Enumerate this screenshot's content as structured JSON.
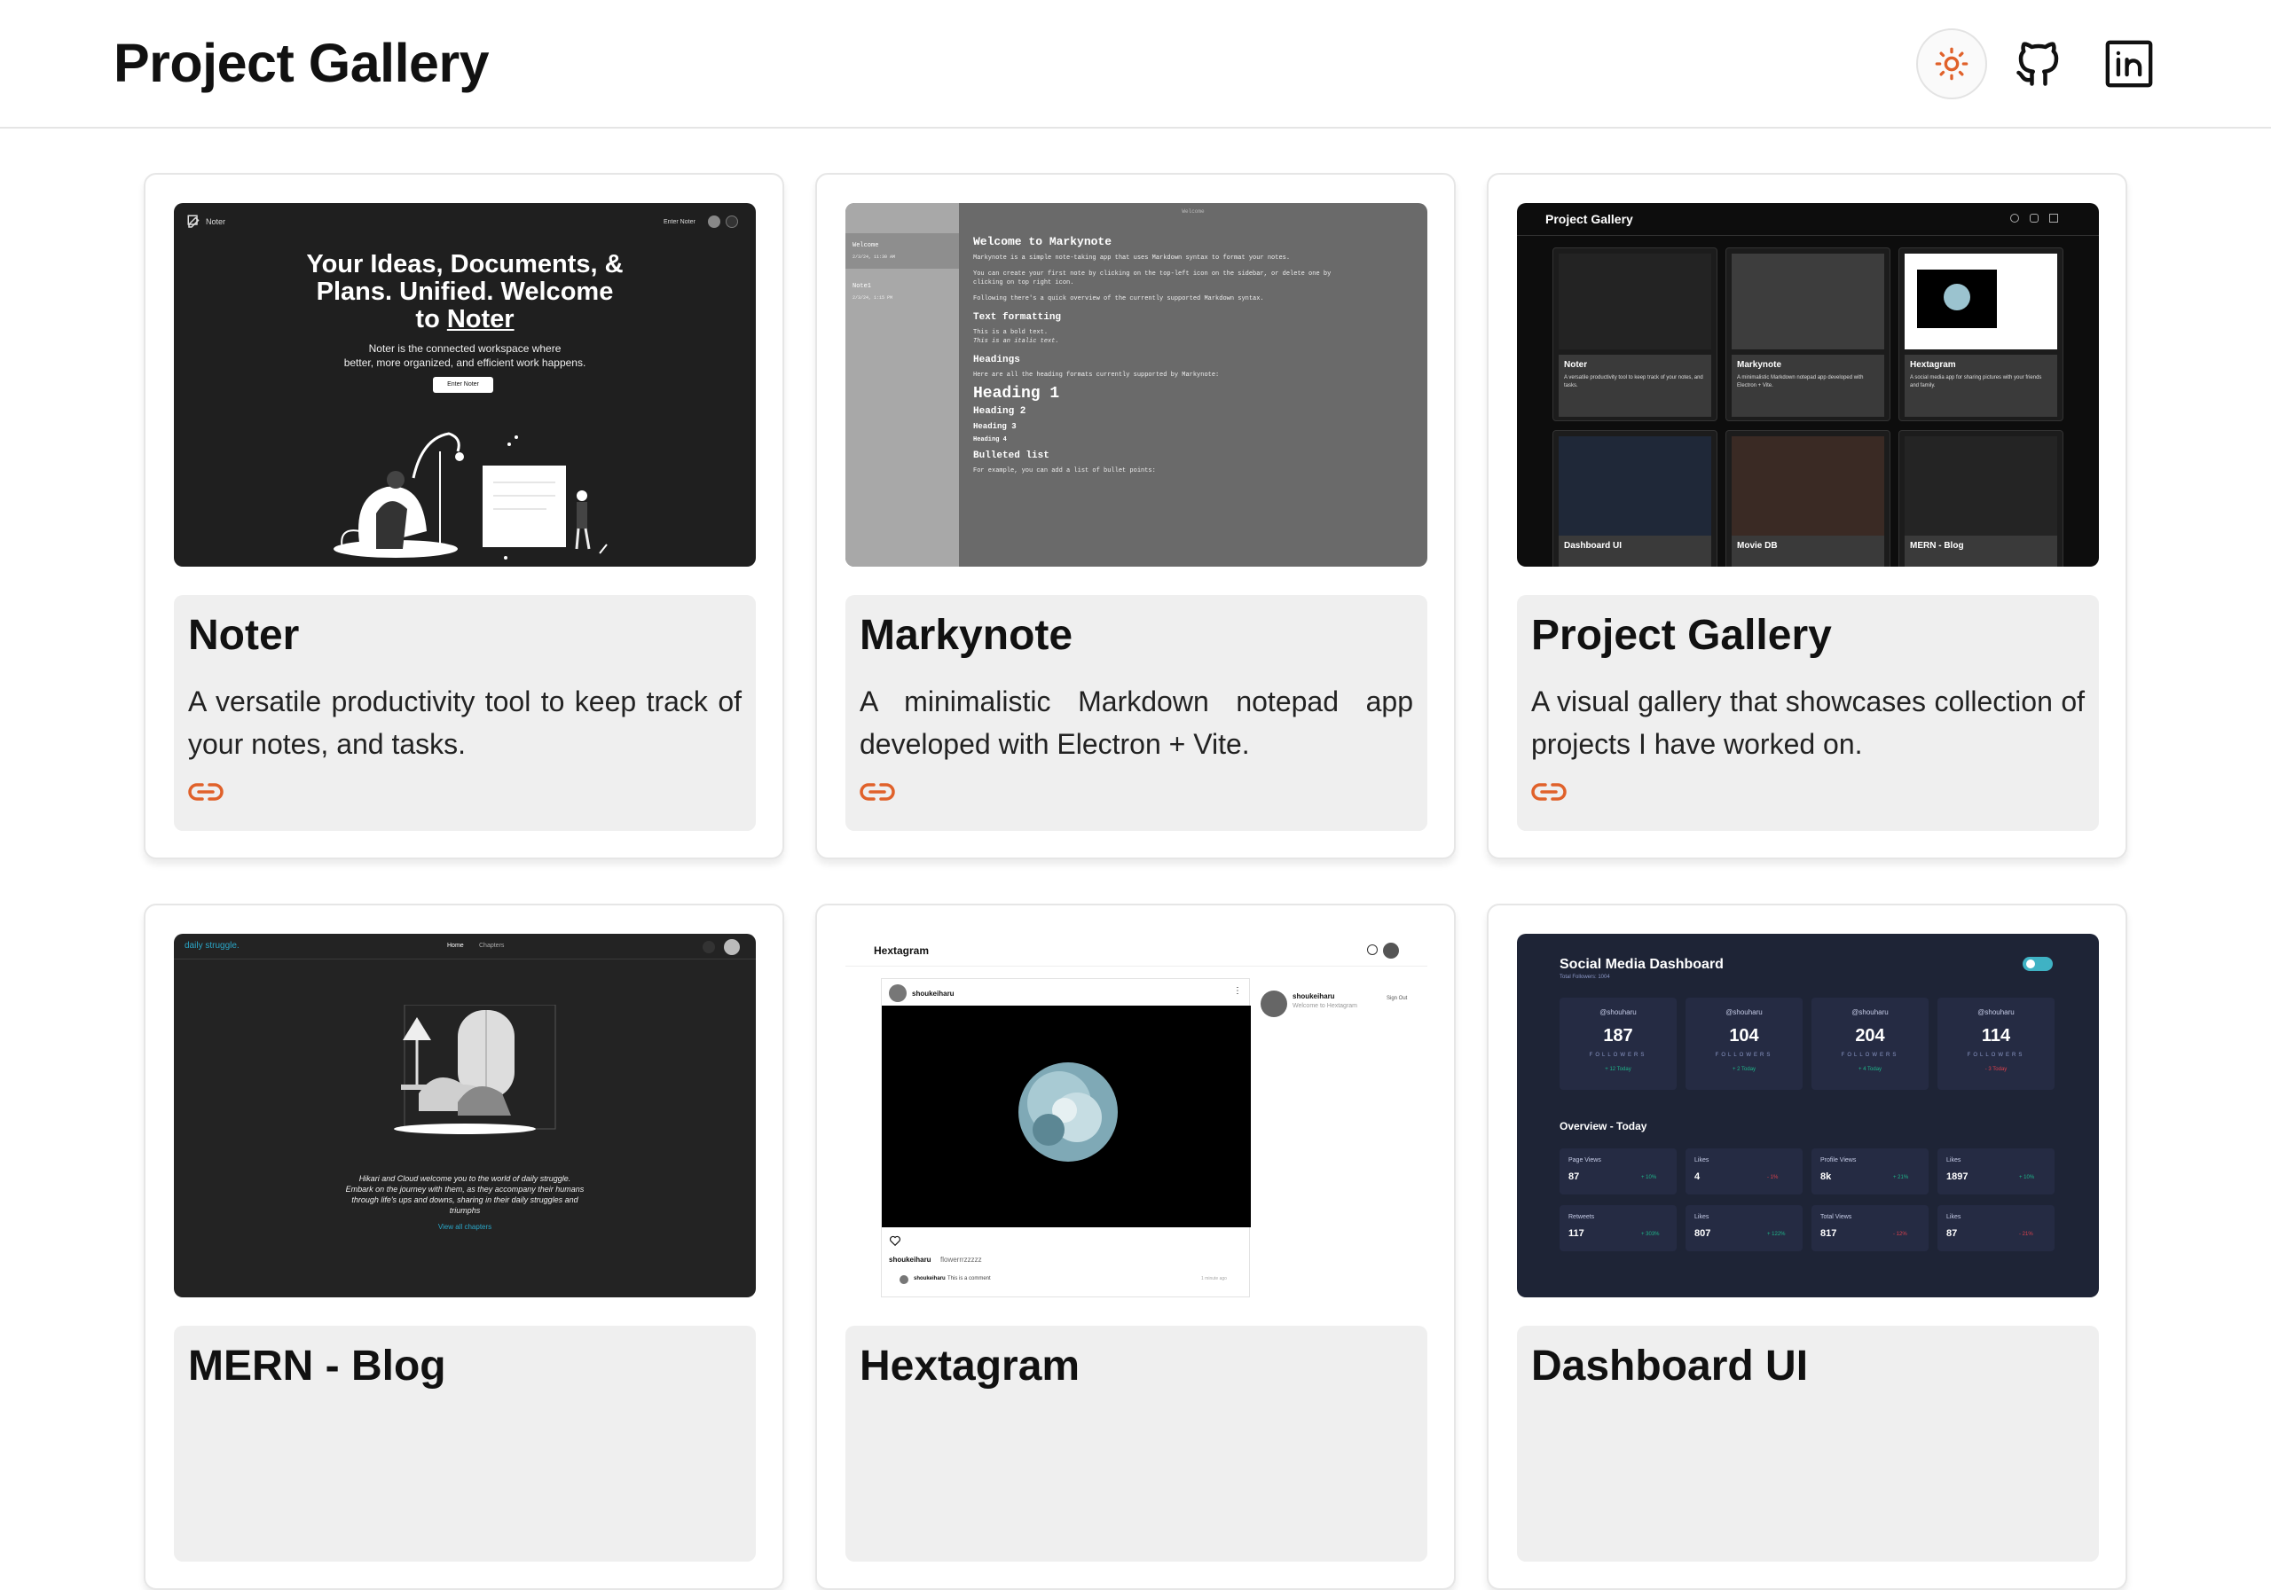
{
  "header": {
    "title": "Project Gallery",
    "theme_icon": "sun-icon",
    "github_icon": "github-icon",
    "linkedin_icon": "linkedin-icon"
  },
  "colors": {
    "accent": "#e0612a",
    "card_info_bg": "#efefef",
    "border": "#e6e6e6"
  },
  "projects": [
    {
      "title": "Noter",
      "description": "A versatile productivity tool to keep track of your notes, and tasks.",
      "link_icon": "link-icon",
      "thumb": {
        "brand": "Noter",
        "enter_btn": "Enter Noter",
        "headline_1": "Your Ideas, Documents, &",
        "headline_2": "Plans. Unified. Welcome",
        "headline_3": "to",
        "headline_brand": "Noter",
        "sub_1": "Noter is the connected workspace where",
        "sub_2": "better, more organized, and efficient work happens.",
        "cta": "Enter Noter"
      }
    },
    {
      "title": "Markynote",
      "description": "A minimalistic Markdown notepad app developed with Electron + Vite.",
      "link_icon": "link-icon",
      "thumb": {
        "window_title": "Welcome",
        "sidebar_1": "Welcome",
        "sidebar_1_date": "2/3/24, 11:30 AM",
        "sidebar_2": "Note1",
        "sidebar_2_date": "2/3/24, 1:15 PM",
        "h_title": "Welcome to Markynote",
        "line_1": "Markynote is a simple note-taking app that uses Markdown syntax to format your notes.",
        "line_2": "You can create your first note by clicking on the top-left icon on the sidebar, or delete one by",
        "line_3": "clicking on top right icon.",
        "line_4": "Following there's a quick overview of the currently supported Markdown syntax.",
        "sec_1": "Text formatting",
        "bold_line": "This is a bold text.",
        "italic_line": "This is an italic text.",
        "sec_2": "Headings",
        "head_desc": "Here are all the heading formats currently supported by Markynote:",
        "h1": "Heading 1",
        "h2": "Heading 2",
        "h3": "Heading 3",
        "h4": "Heading 4",
        "sec_3": "Bulleted list",
        "list_desc": "For example, you can add a list of bullet points:"
      }
    },
    {
      "title": "Project Gallery",
      "description": "A visual gallery that showcases collection of projects I have worked on.",
      "link_icon": "link-icon",
      "thumb": {
        "title": "Project Gallery",
        "mini_cards": [
          {
            "title": "Noter",
            "desc": "A versatile productivity tool to keep track of your notes, and tasks."
          },
          {
            "title": "Markynote",
            "desc": "A minimalistic Markdown notepad app developed with Electron + Vite."
          },
          {
            "title": "Hextagram",
            "desc": "A social media app for sharing pictures with your friends and family."
          },
          {
            "title": "Dashboard UI",
            "desc": ""
          },
          {
            "title": "Movie DB",
            "desc": ""
          },
          {
            "title": "MERN - Blog",
            "desc": ""
          }
        ]
      }
    },
    {
      "title": "MERN - Blog",
      "description": "",
      "link_icon": "link-icon",
      "thumb": {
        "brand": "daily struggle.",
        "nav_1": "Home",
        "nav_2": "Chapters",
        "text_1": "Hikari and Cloud welcome you to the world of daily struggle.",
        "text_2": "Embark on the journey with them, as they accompany their humans",
        "text_3": "through life's ups and downs, sharing in their daily struggles and",
        "text_4": "triumphs",
        "cta": "View all chapters"
      }
    },
    {
      "title": "Hextagram",
      "description": "",
      "link_icon": "link-icon",
      "thumb": {
        "brand": "Hextagram",
        "post_user": "shoukeiharu",
        "side_user": "shoukeiharu",
        "side_sub": "Welcome to Hextagram",
        "signout": "Sign Out",
        "caption_user": "shoukeiharu",
        "caption": "flowerrrzzzzz",
        "comment_user": "shoukeiharu",
        "comment": "This is a comment",
        "comment_time": "1 minute ago"
      }
    },
    {
      "title": "Dashboard UI",
      "description": "",
      "link_icon": "link-icon",
      "thumb": {
        "title": "Social Media Dashboard",
        "subtitle": "Total Followers: 1004",
        "followers": [
          {
            "handle": "@shouharu",
            "count": "187",
            "label": "FOLLOWERS",
            "delta": "+ 12 Today",
            "color": "#1eb589"
          },
          {
            "handle": "@shouharu",
            "count": "104",
            "label": "FOLLOWERS",
            "delta": "+ 2 Today",
            "color": "#1eb589"
          },
          {
            "handle": "@shouharu",
            "count": "204",
            "label": "FOLLOWERS",
            "delta": "+ 4 Today",
            "color": "#1eb589"
          },
          {
            "handle": "@shouharu",
            "count": "114",
            "label": "FOLLOWERS",
            "delta": "- 3 Today",
            "color": "#dc414c"
          }
        ],
        "overview_title": "Overview - Today",
        "overview": [
          {
            "label": "Page Views",
            "value": "87",
            "delta": "+ 10%",
            "color": "#1eb589"
          },
          {
            "label": "Likes",
            "value": "4",
            "delta": "- 1%",
            "color": "#dc414c"
          },
          {
            "label": "Profile Views",
            "value": "8k",
            "delta": "+ 21%",
            "color": "#1eb589"
          },
          {
            "label": "Likes",
            "value": "1897",
            "delta": "+ 10%",
            "color": "#1eb589"
          },
          {
            "label": "Retweets",
            "value": "117",
            "delta": "+ 303%",
            "color": "#1eb589"
          },
          {
            "label": "Likes",
            "value": "807",
            "delta": "+ 122%",
            "color": "#1eb589"
          },
          {
            "label": "Total Views",
            "value": "817",
            "delta": "- 12%",
            "color": "#dc414c"
          },
          {
            "label": "Likes",
            "value": "87",
            "delta": "- 21%",
            "color": "#dc414c"
          }
        ]
      }
    }
  ]
}
